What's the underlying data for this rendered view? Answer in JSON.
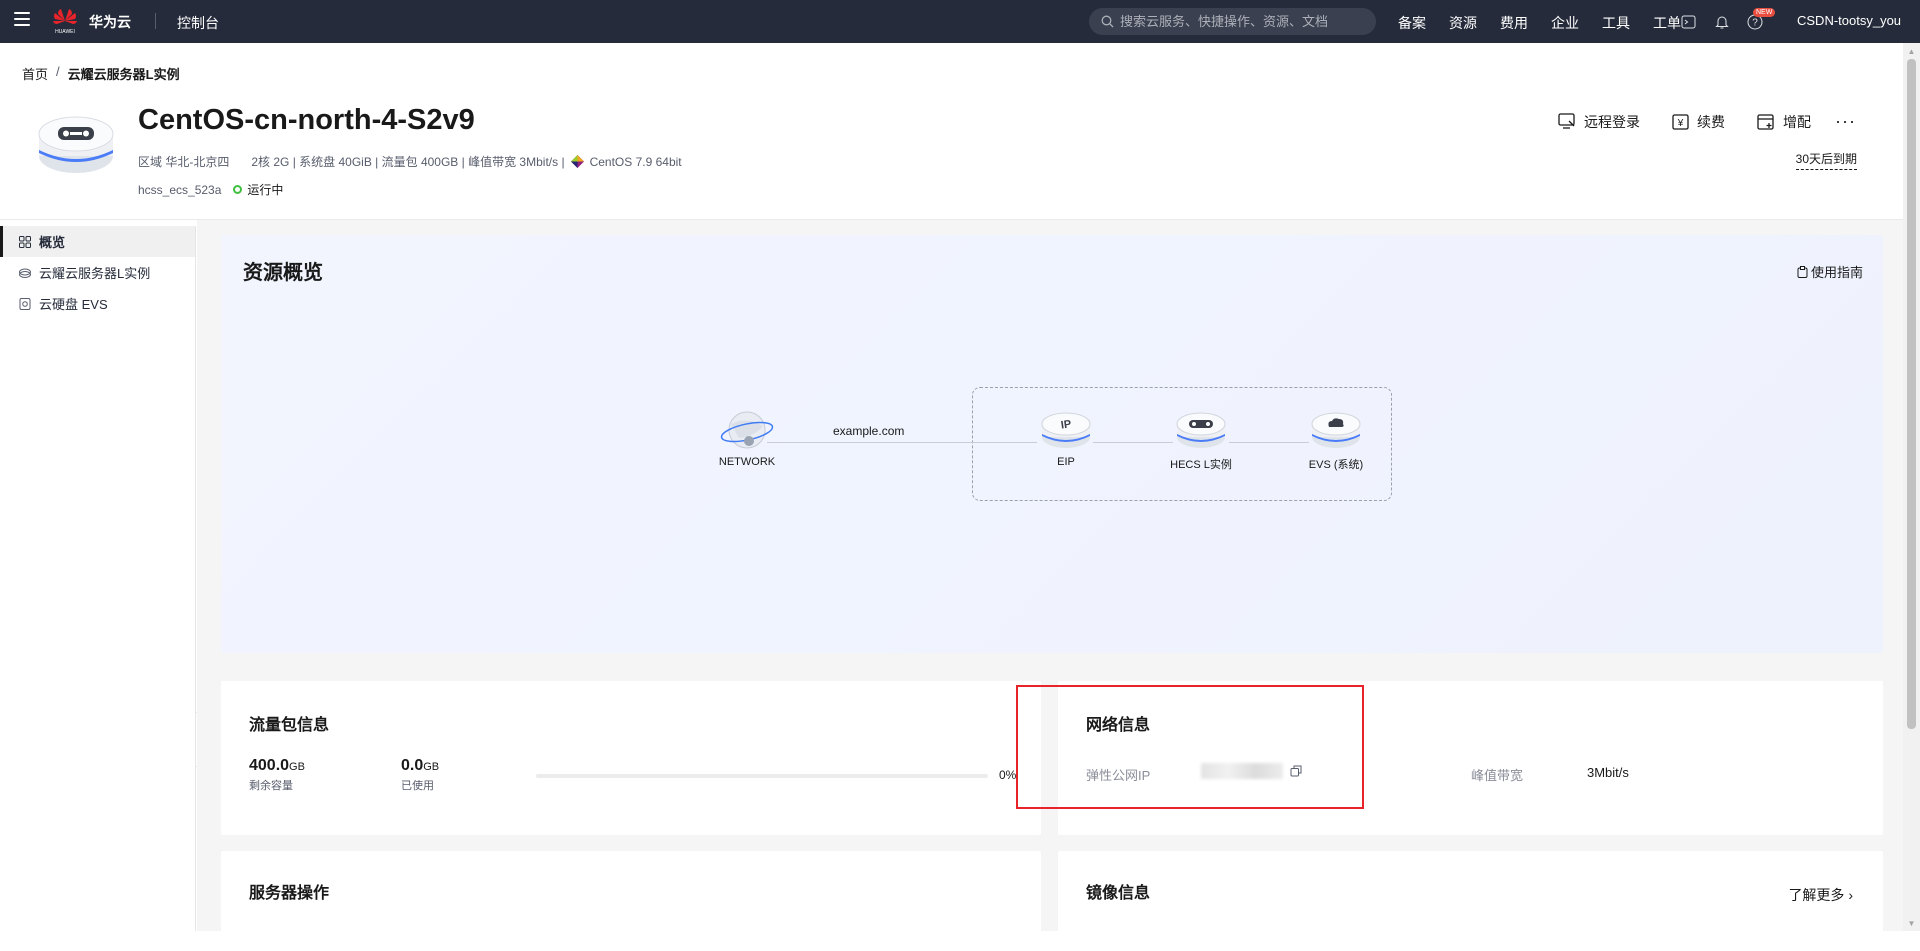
{
  "topbar": {
    "brand": "华为云",
    "logo_text": "HUAWEI",
    "console": "控制台",
    "search_placeholder": "搜索云服务、快捷操作、资源、文档",
    "links": [
      "备案",
      "资源",
      "费用",
      "企业",
      "工具",
      "工单"
    ],
    "new_badge": "NEW",
    "user": "CSDN-tootsy_you"
  },
  "breadcrumb": {
    "home": "首页",
    "separator": "/",
    "current": "云耀云服务器L实例"
  },
  "instance": {
    "title": "CentOS-cn-north-4-S2v9",
    "region": "区域 华北-北京四",
    "specs": "2核  2G | 系统盘 40GiB | 流量包 400GB | 峰值带宽 3Mbit/s |",
    "os": "CentOS 7.9 64bit",
    "id": "hcss_ecs_523a",
    "status": "运行中",
    "status_color": "#3fbf3f"
  },
  "actions": {
    "remote_login": "远程登录",
    "renew": "续费",
    "upgrade": "增配",
    "more": "···",
    "expire": "30天后到期"
  },
  "sidebar": {
    "items": [
      {
        "label": "概览",
        "icon": "grid-icon",
        "active": true
      },
      {
        "label": "云耀云服务器L实例",
        "icon": "cloud-server-icon",
        "active": false
      },
      {
        "label": "云硬盘 EVS",
        "icon": "disk-icon",
        "active": false
      }
    ]
  },
  "overview": {
    "title": "资源概览",
    "guide": "使用指南",
    "domain": "example.com",
    "nodes": {
      "network": "NETWORK",
      "eip": "EIP",
      "hecs": "HECS L实例",
      "evs": "EVS (系统)"
    }
  },
  "traffic": {
    "title": "流量包信息",
    "remaining_value": "400.0",
    "remaining_unit": "GB",
    "remaining_label": "剩余容量",
    "used_value": "0.0",
    "used_unit": "GB",
    "used_label": "已使用",
    "used_percent": 0,
    "percent_text": "0%"
  },
  "network": {
    "title": "网络信息",
    "eip_label": "弹性公网IP",
    "bandwidth_label": "峰值带宽",
    "bandwidth_value": "3Mbit/s"
  },
  "server_ops": {
    "title": "服务器操作"
  },
  "image": {
    "title": "镜像信息",
    "learn_more": "了解更多 ›"
  },
  "colors": {
    "topbar": "#252b3a",
    "accent": "#5e7ce0",
    "highlight": "#e8242a"
  }
}
